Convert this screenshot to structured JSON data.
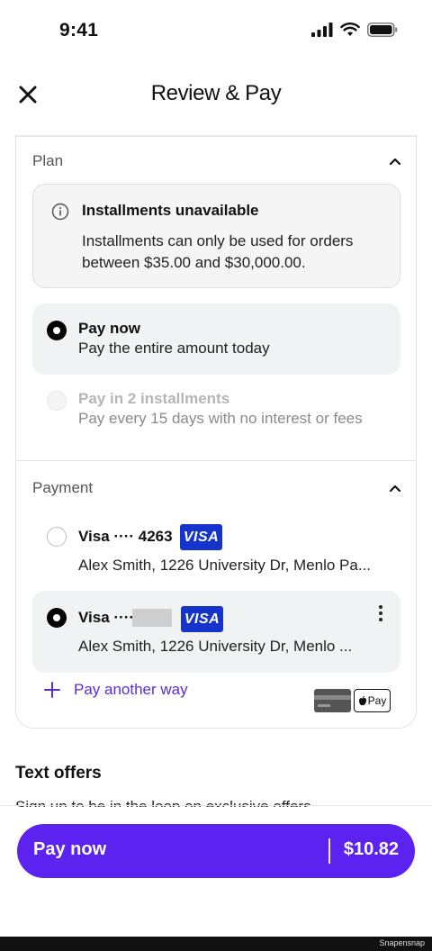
{
  "status_bar": {
    "time": "9:41"
  },
  "nav": {
    "title": "Review & Pay"
  },
  "plan": {
    "title": "Plan",
    "notice": {
      "title": "Installments unavailable",
      "body": "Installments can only be used for orders between $35.00 and $30,000.00."
    },
    "options": [
      {
        "title": "Pay now",
        "subtitle": "Pay the entire amount today",
        "selected": true,
        "disabled": false
      },
      {
        "title": "Pay in 2 installments",
        "subtitle": "Pay every 15 days with no interest or fees",
        "selected": false,
        "disabled": true
      }
    ]
  },
  "payment": {
    "title": "Payment",
    "methods": [
      {
        "label": "Visa ···· 4263",
        "brand": "VISA",
        "address": "Alex Smith, 1226 University Dr, Menlo Pa...",
        "selected": false
      },
      {
        "label": "Visa ····",
        "brand": "VISA",
        "address": "Alex Smith, 1226 University Dr, Menlo ...",
        "selected": true
      }
    ],
    "add_label": "Pay another way",
    "apple_pay_label": "Pay"
  },
  "offers": {
    "title": "Text offers",
    "subtitle": "Sign up to be in the loop on exclusive offers"
  },
  "pay_button": {
    "label": "Pay now",
    "amount": "$10.82"
  },
  "footer": {
    "watermark": "Snapensnap"
  },
  "colors": {
    "accent": "#5b22f0",
    "link": "#5b2bd9",
    "visa": "#1434cb"
  }
}
